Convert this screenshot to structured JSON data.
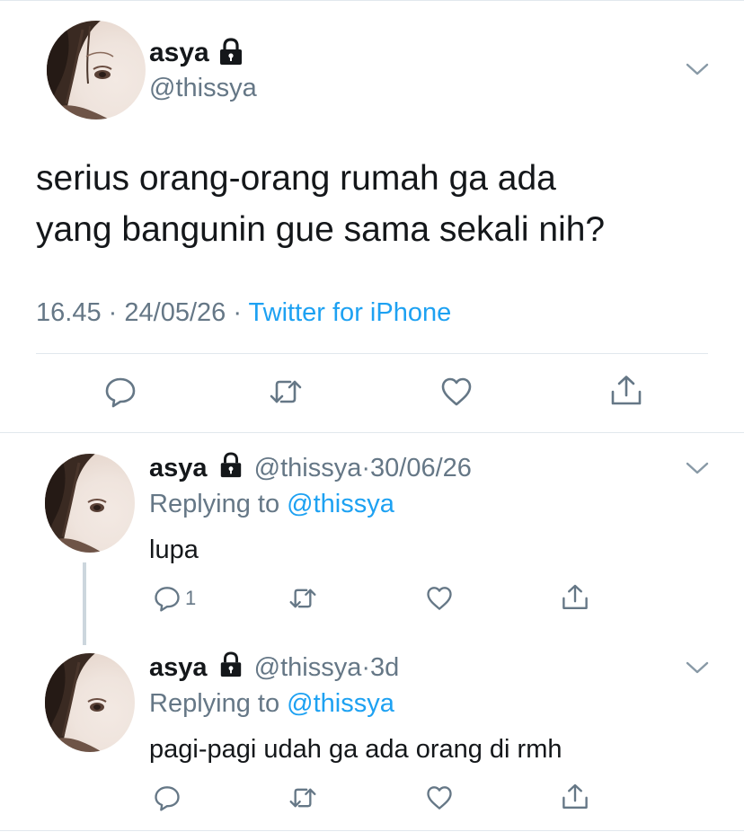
{
  "main_tweet": {
    "display_name": "asya",
    "handle": "@thissya",
    "text_line1": "serius orang-orang rumah ga ada",
    "text_line2": "yang bangunin gue sama sekali nih?",
    "time": "16.45",
    "date": "24/05/26",
    "separator": "·",
    "source": "Twitter for iPhone"
  },
  "replies": [
    {
      "display_name": "asya",
      "handle": "@thissya",
      "separator": "·",
      "date": "30/06/26",
      "replying_prefix": "Replying to",
      "replying_to": "@thissya",
      "text": "lupa",
      "reply_count": "1"
    },
    {
      "display_name": "asya",
      "handle": "@thissya",
      "separator": "·",
      "date": "3d",
      "replying_prefix": "Replying to",
      "replying_to": "@thissya",
      "text": "pagi-pagi udah ga ada orang di rmh",
      "reply_count": ""
    }
  ],
  "icons": {
    "lock": "lock-icon",
    "caret": "chevron-down-icon",
    "reply": "reply-icon",
    "retweet": "retweet-icon",
    "like": "heart-icon",
    "share": "share-icon"
  },
  "colors": {
    "text": "#14171a",
    "secondary": "#657786",
    "link": "#1da1f2",
    "border": "#e1e8ed",
    "thread_line": "#ccd6dd"
  }
}
